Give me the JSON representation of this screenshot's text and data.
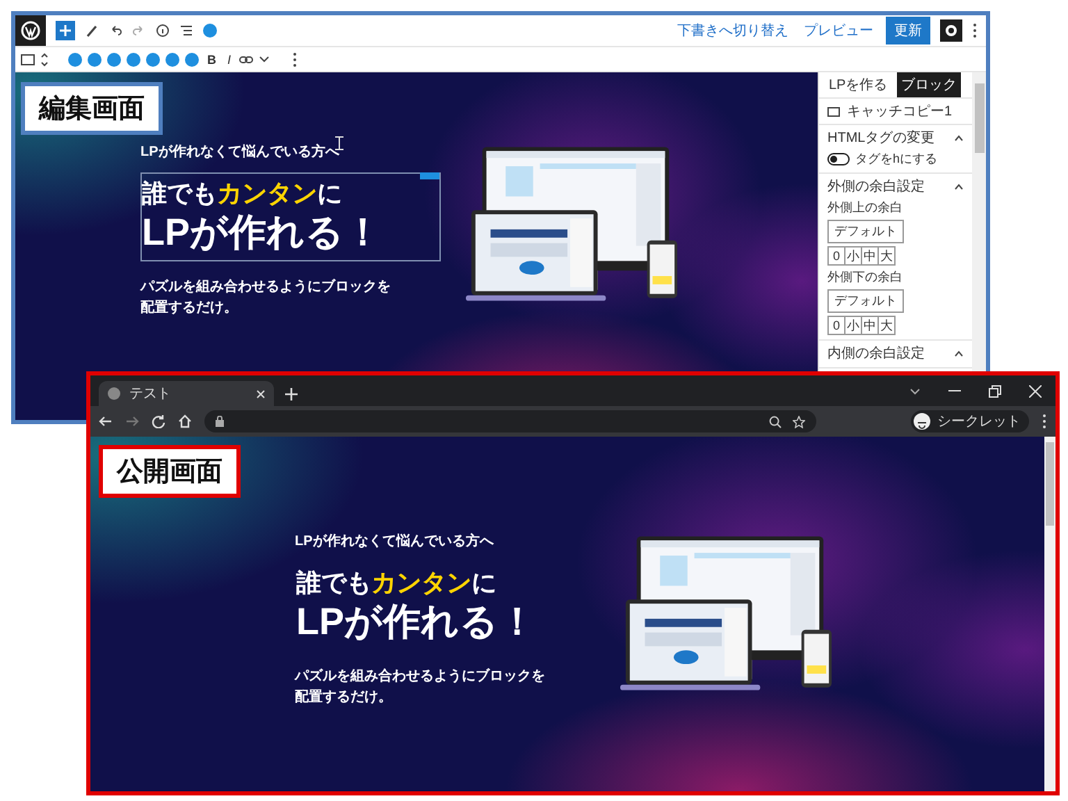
{
  "editor": {
    "label": "編集画面",
    "toolbar": {
      "actions": [
        "下書きへ切り替え",
        "プレビュー"
      ],
      "update_button": "更新"
    },
    "format_buttons": [
      "B",
      "I"
    ],
    "hero": {
      "subtitle": "LPが作れなくて悩んでいる方へ",
      "headline_selected": true,
      "headline": [
        [
          {
            "text": "誰でも",
            "highlight": false
          },
          {
            "text": "カンタン",
            "highlight": true
          },
          {
            "text": "に",
            "highlight": false
          }
        ],
        [
          {
            "text": "LPが作れる！",
            "highlight": false
          }
        ]
      ],
      "body": [
        "パズルを組み合わせるようにブロックを",
        "配置するだけ。"
      ]
    },
    "sidebar": {
      "tabs": [
        {
          "label": "LPを作る",
          "selected": false
        },
        {
          "label": "ブロック",
          "selected": true
        }
      ],
      "block_name": "キャッチコピー1",
      "panels": [
        {
          "title": "HTMLタグの変更",
          "expanded": true,
          "rows": [
            {
              "kind": "toggle",
              "label": "タグをhにする",
              "on": false
            }
          ]
        },
        {
          "title": "外側の余白設定",
          "expanded": true,
          "rows": [
            {
              "kind": "label",
              "label": "外側上の余白"
            },
            {
              "kind": "button",
              "label": "デフォルト"
            },
            {
              "kind": "segments",
              "options": [
                "0",
                "小",
                "中",
                "大"
              ]
            },
            {
              "kind": "label",
              "label": "外側下の余白"
            },
            {
              "kind": "button",
              "label": "デフォルト"
            },
            {
              "kind": "segments",
              "options": [
                "0",
                "小",
                "中",
                "大"
              ]
            }
          ]
        },
        {
          "title": "内側の余白設定",
          "expanded": true
        }
      ]
    }
  },
  "browser": {
    "label": "公開画面",
    "tab": {
      "title": "テスト"
    },
    "profile": "シークレット",
    "hero": {
      "subtitle": "LPが作れなくて悩んでいる方へ",
      "headline_selected": false,
      "headline": [
        [
          {
            "text": "誰でも",
            "highlight": false
          },
          {
            "text": "カンタン",
            "highlight": true
          },
          {
            "text": "に",
            "highlight": false
          }
        ],
        [
          {
            "text": "LPが作れる！",
            "highlight": false
          }
        ]
      ],
      "body": [
        "パズルを組み合わせるようにブロックを",
        "配置するだけ。"
      ]
    }
  }
}
